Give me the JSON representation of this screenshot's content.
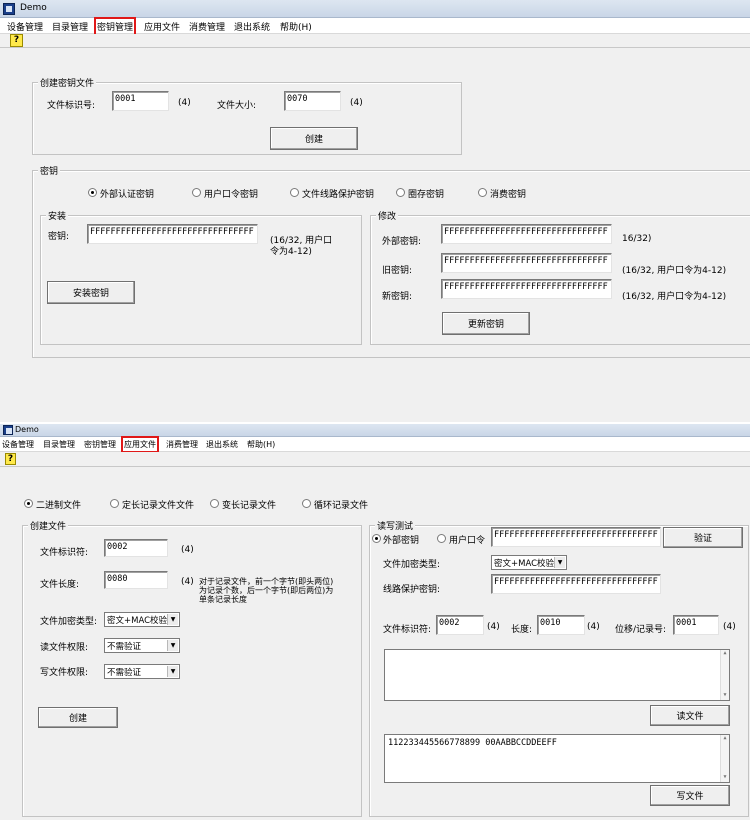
{
  "window1": {
    "title": "Demo",
    "menu": [
      "设备管理",
      "目录管理",
      "密钥管理",
      "应用文件",
      "消费管理",
      "退出系统",
      "帮助(H)"
    ],
    "create_key_file": {
      "legend": "创建密钥文件",
      "file_id_label": "文件标识号:",
      "file_id_value": "0001",
      "file_id_hint": "(4)",
      "file_size_label": "文件大小:",
      "file_size_value": "0070",
      "file_size_hint": "(4)",
      "create_button": "创建"
    },
    "key_group": {
      "legend": "密钥",
      "radios": [
        "外部认证密钥",
        "用户口令密钥",
        "文件线路保护密钥",
        "圈存密钥",
        "消费密钥"
      ],
      "selected": "外部认证密钥"
    },
    "install": {
      "legend": "安装",
      "key_label": "密钥:",
      "key_value": "FFFFFFFFFFFFFFFFFFFFFFFFFFFFFFFF",
      "hint_line1": "(16/32, 用户口",
      "hint_line2": "令为4-12)",
      "install_button": "安装密钥"
    },
    "modify": {
      "legend": "修改",
      "ext_key_label": "外部密钥:",
      "ext_key_value": "FFFFFFFFFFFFFFFFFFFFFFFFFFFFFFFF",
      "ext_key_hint": "16/32)",
      "old_key_label": "旧密钥:",
      "old_key_value": "FFFFFFFFFFFFFFFFFFFFFFFFFFFFFFFF",
      "old_key_hint": "(16/32, 用户口令为4-12)",
      "new_key_label": "新密钥:",
      "new_key_value": "FFFFFFFFFFFFFFFFFFFFFFFFFFFFFFFF",
      "new_key_hint": "(16/32, 用户口令为4-12)",
      "update_button": "更新密钥"
    }
  },
  "window2": {
    "title": "Demo",
    "menu": [
      "设备管理",
      "目录管理",
      "密钥管理",
      "应用文件",
      "消费管理",
      "退出系统",
      "帮助(H)"
    ],
    "file_type_radios": [
      "二进制文件",
      "定长记录文件文件",
      "变长记录文件",
      "循环记录文件"
    ],
    "file_type_selected": "二进制文件",
    "create_file": {
      "legend": "创建文件",
      "file_id_label": "文件标识符:",
      "file_id_value": "0002",
      "file_id_hint": "(4)",
      "file_len_label": "文件长度:",
      "file_len_value": "0080",
      "file_len_hint": "(4)",
      "note_line1": "对于记录文件，前一个字节(即头两位)",
      "note_line2": "为记录个数，后一个字节(即后两位)为",
      "note_line3": "单条记录长度",
      "enc_type_label": "文件加密类型:",
      "enc_type_value": "密文+MAC校验",
      "read_perm_label": "读文件权限:",
      "read_perm_value": "不需验证",
      "write_perm_label": "写文件权限:",
      "write_perm_value": "不需验证",
      "create_button": "创建"
    },
    "rw_test": {
      "legend": "读写测试",
      "radio_ext_key": "外部密钥",
      "radio_user_pin": "用户口令",
      "selected": "外部密钥",
      "key_value": "FFFFFFFFFFFFFFFFFFFFFFFFFFFFFFFF",
      "verify_button": "验证",
      "enc_type_label": "文件加密类型:",
      "enc_type_value": "密文+MAC校验",
      "line_key_label": "线路保护密钥:",
      "line_key_value": "FFFFFFFFFFFFFFFFFFFFFFFFFFFFFFFF",
      "file_id_label": "文件标识符:",
      "file_id_value": "0002",
      "file_id_hint": "(4)",
      "length_label": "长度:",
      "length_value": "0010",
      "length_hint": "(4)",
      "offset_label": "位移/记录号:",
      "offset_value": "0001",
      "offset_hint": "(4)",
      "read_output": "",
      "read_button": "读文件",
      "write_input": "112233445566778899 00AABBCCDDEEFF",
      "write_button": "写文件"
    }
  }
}
